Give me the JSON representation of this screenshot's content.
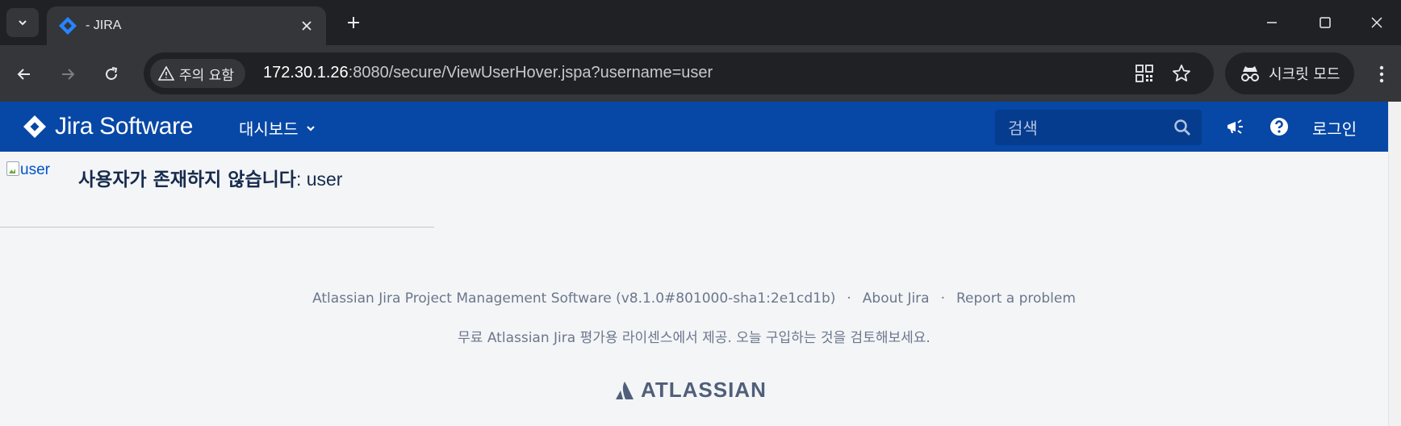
{
  "browser": {
    "tab": {
      "title": "- JIRA"
    },
    "omnibox": {
      "security_label": "주의 요함",
      "url_host": "172.30.1.26",
      "url_rest": ":8080/secure/ViewUserHover.jspa?username=user"
    },
    "incognito_label": "시크릿 모드"
  },
  "header": {
    "logo_text": "Jira Software",
    "dashboard_menu": "대시보드",
    "search_placeholder": "검색",
    "login_label": "로그인"
  },
  "content": {
    "avatar_alt": "user",
    "heading_prefix": "사용자가 존재하지 않습니다",
    "heading_user": ": user"
  },
  "footer": {
    "product_info": "Atlassian Jira Project Management Software (v8.1.0#801000-sha1:2e1cd1b)",
    "separator": "·",
    "about_link": "About Jira",
    "report_link": "Report a problem",
    "license_text": "무료 Atlassian Jira 평가용 라이센스에서 제공. 오늘 구입하는 것을 검토해보세요.",
    "brand": "ATLASSIAN"
  },
  "colors": {
    "jira_header": "#0747a6",
    "chrome_dark": "#202124",
    "chrome_toolbar": "#35363a",
    "page_bg": "#f4f5f7",
    "link_blue": "#0052cc"
  }
}
